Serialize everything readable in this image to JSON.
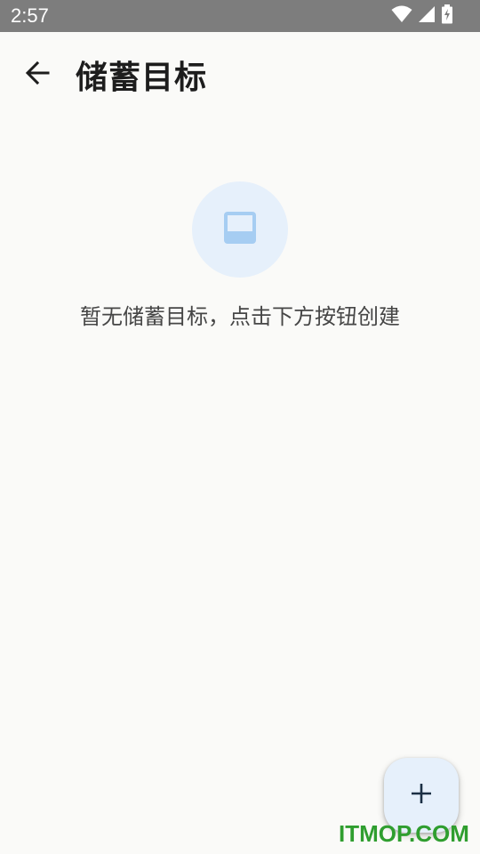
{
  "status_bar": {
    "time": "2:57",
    "icons": [
      "wifi-icon",
      "cellular-signal-icon",
      "battery-charging-icon"
    ]
  },
  "app_bar": {
    "back_icon": "arrow-left-icon",
    "title": "储蓄目标"
  },
  "empty_state": {
    "icon": "inbox-icon",
    "message": "暂无储蓄目标，点击下方按钮创建"
  },
  "fab": {
    "icon": "plus-icon"
  },
  "watermark": {
    "text": "ITMOP.COM"
  },
  "colors": {
    "status_bar": "#7d7d7d",
    "background": "#fafaf8",
    "accent_light": "#e6f0fb",
    "icon_blue": "#a6cdf2",
    "fab_icon": "#1b2f44",
    "watermark": "#2f9e2f"
  }
}
